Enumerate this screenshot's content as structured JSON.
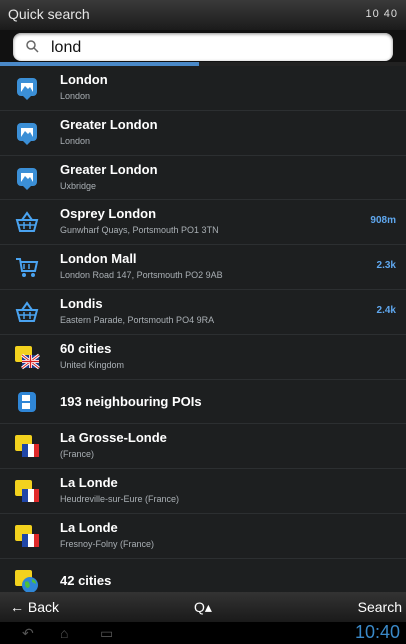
{
  "header": {
    "title": "Quick search",
    "status": "10  40"
  },
  "search": {
    "value": "lond",
    "progress": 0.49
  },
  "results": [
    {
      "name": "London",
      "sub": "London",
      "dist": "",
      "icon": "map-pin-icon"
    },
    {
      "name": "Greater London",
      "sub": "London",
      "dist": "",
      "icon": "map-pin-icon"
    },
    {
      "name": "Greater London",
      "sub": "Uxbridge",
      "dist": "",
      "icon": "map-pin-icon"
    },
    {
      "name": "Osprey London",
      "sub": "Gunwharf Quays,  Portsmouth PO1 3TN",
      "dist": "908m",
      "icon": "shopping-basket-icon"
    },
    {
      "name": "London Mall",
      "sub": "London Road 147,  Portsmouth PO2 9AB",
      "dist": "2.3k",
      "icon": "shopping-cart-icon"
    },
    {
      "name": "Londis",
      "sub": "Eastern Parade,  Portsmouth PO4 9RA",
      "dist": "2.4k",
      "icon": "shopping-basket-icon"
    },
    {
      "name": "60 cities",
      "sub": "United Kingdom",
      "dist": "",
      "icon": "uk-flag-folder-icon"
    },
    {
      "name": "193 neighbouring POIs",
      "sub": "",
      "dist": "",
      "icon": "fuel-icon"
    },
    {
      "name": "La Grosse-Londe",
      "sub": "(France)",
      "dist": "",
      "icon": "france-flag-folder-icon"
    },
    {
      "name": "La Londe",
      "sub": "Heudreville-sur-Eure (France)",
      "dist": "",
      "icon": "france-flag-folder-icon"
    },
    {
      "name": "La Londe",
      "sub": "Fresnoy-Folny (France)",
      "dist": "",
      "icon": "france-flag-folder-icon"
    },
    {
      "name": "42 cities",
      "sub": "",
      "dist": "",
      "icon": "globe-folder-icon"
    }
  ],
  "bottom": {
    "back": "Back",
    "search_menu": "Q",
    "search": "Search"
  },
  "navbar": {
    "clock": "10:40"
  },
  "colors": {
    "accent": "#3a89c8",
    "dist": "#5fa7ee"
  }
}
